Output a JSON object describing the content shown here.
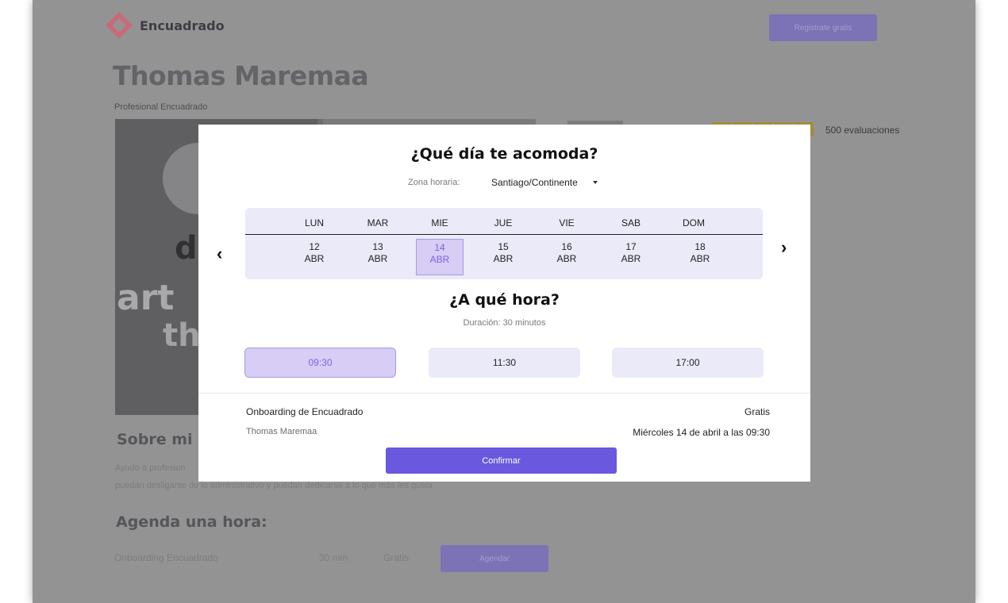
{
  "header": {
    "logo_text": "Encuadrado",
    "signup_label": "Registrate gratis"
  },
  "profile": {
    "name": "Thomas Maremaa",
    "subtitle": "Profesional Encuadrado",
    "reviews": "500 evaluaciones",
    "photo_text": [
      "art",
      "d",
      "th"
    ]
  },
  "about": {
    "title": "Sobre mi",
    "text_line1": "Ayudo a profesion",
    "text_line2": "puedan desligarse de lo administrativo y puedan dedicarse a lo que más les gusta"
  },
  "agenda": {
    "title": "Agenda una hora:",
    "service": "Onboarding Encuadrado",
    "duration": "30 min",
    "price": "Gratis",
    "button_label": "Agendar"
  },
  "modal": {
    "title": "¿Qué día te acomoda?",
    "timezone_label": "Zona horaria:",
    "timezone_value": "Santiago/Continente",
    "days": [
      {
        "name": "LUN",
        "day": "12",
        "month": "ABR",
        "selected": false
      },
      {
        "name": "MAR",
        "day": "13",
        "month": "ABR",
        "selected": false
      },
      {
        "name": "MIE",
        "day": "14",
        "month": "ABR",
        "selected": true
      },
      {
        "name": "JUE",
        "day": "15",
        "month": "ABR",
        "selected": false
      },
      {
        "name": "VIE",
        "day": "16",
        "month": "ABR",
        "selected": false
      },
      {
        "name": "SAB",
        "day": "17",
        "month": "ABR",
        "selected": false
      },
      {
        "name": "DOM",
        "day": "18",
        "month": "ABR",
        "selected": false
      }
    ],
    "prev_icon": "chevron-left-icon",
    "next_icon": "chevron-right-icon",
    "time_title": "¿A qué hora?",
    "duration_text": "Duración: 30 minutos",
    "slots": [
      {
        "time": "09:30",
        "selected": true
      },
      {
        "time": "11:30",
        "selected": false
      },
      {
        "time": "17:00",
        "selected": false
      }
    ],
    "summary": {
      "service": "Onboarding de Encuadrado",
      "price": "Gratis",
      "professional": "Thomas Maremaa",
      "datetime": "Miércoles 14 de abril a las 09:30"
    },
    "confirm_label": "Confirmar"
  },
  "colors": {
    "accent": "#6a58df",
    "selected_bg": "#d7cdf5",
    "selected_text": "#7e64de",
    "calendar_bg": "#ebeaf9",
    "overlay": "#939394"
  }
}
